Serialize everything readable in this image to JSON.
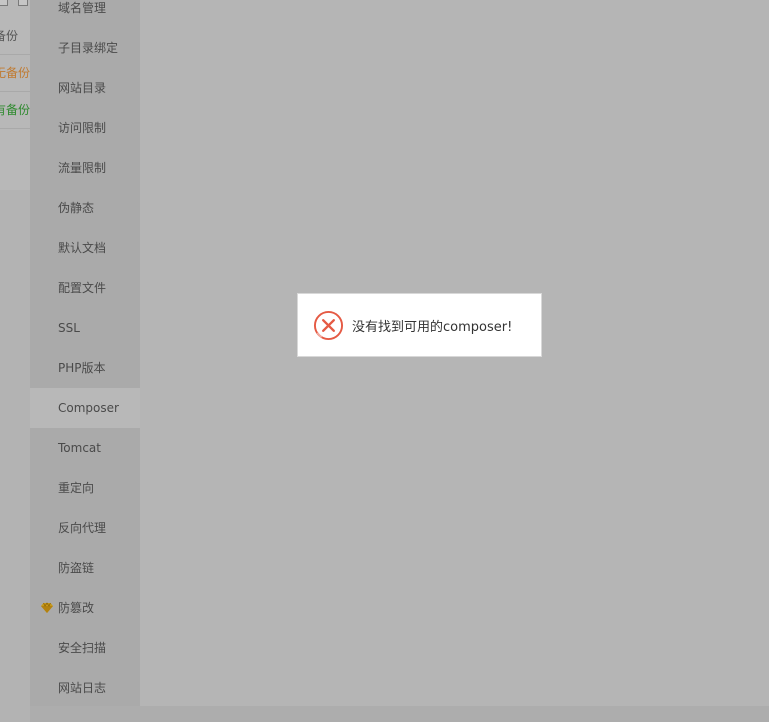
{
  "background": {
    "rows": [
      {
        "label": "备份",
        "color": "#555555"
      },
      {
        "label": "无备份",
        "color": "#c07a30"
      },
      {
        "label": "有备份",
        "color": "#2e8a2e"
      }
    ]
  },
  "sidebar": {
    "items": [
      {
        "label": "域名管理",
        "active": false
      },
      {
        "label": "子目录绑定",
        "active": false
      },
      {
        "label": "网站目录",
        "active": false
      },
      {
        "label": "访问限制",
        "active": false
      },
      {
        "label": "流量限制",
        "active": false
      },
      {
        "label": "伪静态",
        "active": false
      },
      {
        "label": "默认文档",
        "active": false
      },
      {
        "label": "配置文件",
        "active": false
      },
      {
        "label": "SSL",
        "active": false
      },
      {
        "label": "PHP版本",
        "active": false
      },
      {
        "label": "Composer",
        "active": true
      },
      {
        "label": "Tomcat",
        "active": false
      },
      {
        "label": "重定向",
        "active": false
      },
      {
        "label": "反向代理",
        "active": false
      },
      {
        "label": "防盗链",
        "active": false
      },
      {
        "label": "防篡改",
        "active": false,
        "icon": "vip-diamond-icon"
      },
      {
        "label": "安全扫描",
        "active": false
      },
      {
        "label": "网站日志",
        "active": false
      }
    ]
  },
  "toast": {
    "icon": "error-circle-x-icon",
    "message": "没有找到可用的composer!",
    "icon_color": "#e55a44"
  }
}
